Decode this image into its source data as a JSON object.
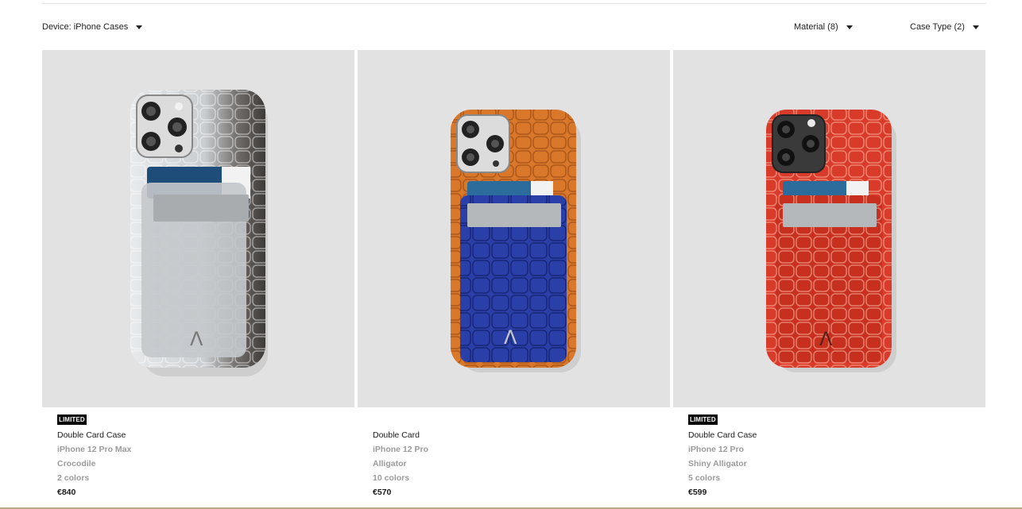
{
  "filters": {
    "device": "Device: iPhone Cases",
    "material": "Material (8)",
    "case_type": "Case Type (2)"
  },
  "products": [
    {
      "badge": "LIMITED",
      "name": "Double Card Case",
      "model": "iPhone 12 Pro Max",
      "material": "Crocodile",
      "colors": "2 colors",
      "price": "€840",
      "case_color": "#cfd3d6",
      "pocket_color": "#bfc4c7"
    },
    {
      "badge": "",
      "name": "Double Card",
      "model": "iPhone 12 Pro",
      "material": "Alligator",
      "colors": "10 colors",
      "price": "€570",
      "case_color": "#d9772a",
      "pocket_color": "#2a3fa8"
    },
    {
      "badge": "LIMITED",
      "name": "Double Card Case",
      "model": "iPhone 12 Pro",
      "material": "Shiny Alligator",
      "colors": "5 colors",
      "price": "€599",
      "case_color": "#d93b2a",
      "pocket_color": "#c7301f"
    }
  ]
}
